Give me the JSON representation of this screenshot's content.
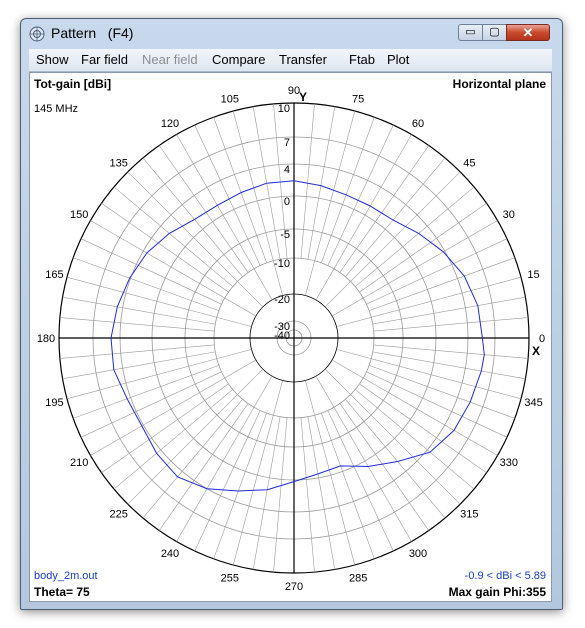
{
  "window": {
    "title": "Pattern   (F4)",
    "minimize_glyph": "▭",
    "maximize_glyph": "▢",
    "close_glyph": "✕"
  },
  "menu": {
    "items": [
      {
        "label": "Show",
        "enabled": true
      },
      {
        "label": "Far field",
        "enabled": true
      },
      {
        "label": "Near field",
        "enabled": false
      },
      {
        "label": "Compare",
        "enabled": true
      },
      {
        "label": "Transfer",
        "enabled": true
      },
      {
        "label": "Ftab",
        "enabled": true
      },
      {
        "label": "Plot",
        "enabled": true
      }
    ]
  },
  "plot": {
    "quantity_label": "Tot-gain [dBi]",
    "frequency_label": "145 MHz",
    "plane_label": "Horizontal plane",
    "file_label": "body_2m.out",
    "theta_label": "Theta= 75",
    "range_label": "-0.9 < dBi < 5.89",
    "max_gain_label": "Max gain Phi:355",
    "y_axis_label": "Y",
    "x_axis_label": "X",
    "trace_color": "#1f2bd6",
    "grid_color": "#9a9a9a",
    "axis_color": "#000000",
    "ring_labels": [
      "10",
      "7",
      "4",
      "0",
      "-5",
      "-10",
      "-20",
      "-30",
      "-40"
    ],
    "angle_labels": [
      "0",
      "15",
      "30",
      "45",
      "60",
      "75",
      "90",
      "105",
      "120",
      "135",
      "150",
      "165",
      "180",
      "195",
      "210",
      "225",
      "240",
      "255",
      "270",
      "285",
      "300",
      "315",
      "330",
      "345"
    ]
  },
  "chart_data": {
    "type": "polar_line",
    "title": "Tot-gain [dBi]",
    "angle_unit": "deg",
    "r_ticks": [
      10,
      7,
      4,
      0,
      -5,
      -10,
      -20,
      -30,
      -40
    ],
    "series": [
      {
        "color": "#1f2bd6",
        "points": [
          [
            0,
            5.6
          ],
          [
            10,
            5.4
          ],
          [
            20,
            4.8
          ],
          [
            30,
            3.8
          ],
          [
            40,
            2.6
          ],
          [
            50,
            1.5
          ],
          [
            60,
            1.3
          ],
          [
            70,
            1.3
          ],
          [
            80,
            1.6
          ],
          [
            90,
            1.9
          ],
          [
            100,
            1.9
          ],
          [
            110,
            1.6
          ],
          [
            120,
            1.4
          ],
          [
            130,
            1.6
          ],
          [
            140,
            2.6
          ],
          [
            150,
            3.5
          ],
          [
            160,
            4.1
          ],
          [
            170,
            4.6
          ],
          [
            180,
            5.0
          ],
          [
            190,
            5.0
          ],
          [
            200,
            4.4
          ],
          [
            210,
            4.2
          ],
          [
            220,
            4.6
          ],
          [
            230,
            4.8
          ],
          [
            240,
            4.0
          ],
          [
            250,
            2.6
          ],
          [
            260,
            1.5
          ],
          [
            270,
            0.2
          ],
          [
            280,
            -0.6
          ],
          [
            290,
            -0.9
          ],
          [
            300,
            0.8
          ],
          [
            310,
            2.4
          ],
          [
            320,
            4.4
          ],
          [
            330,
            5.2
          ],
          [
            340,
            5.5
          ],
          [
            350,
            5.8
          ],
          [
            355,
            5.89
          ]
        ]
      }
    ]
  }
}
